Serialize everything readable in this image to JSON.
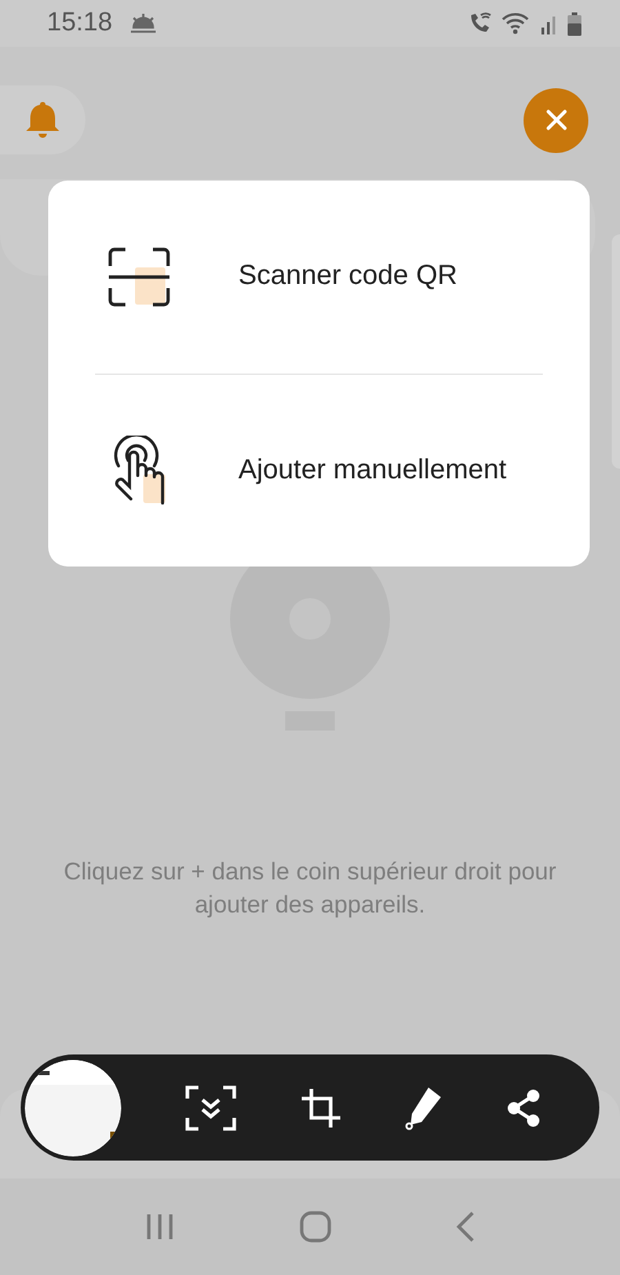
{
  "status_bar": {
    "time": "15:18"
  },
  "menu": {
    "items": [
      {
        "kind": "qr",
        "label": "Scanner code QR"
      },
      {
        "kind": "manual",
        "label": "Ajouter manuellement"
      }
    ]
  },
  "empty_state": {
    "hint": "Cliquez sur + dans le coin supérieur droit pour ajouter des appareils."
  }
}
